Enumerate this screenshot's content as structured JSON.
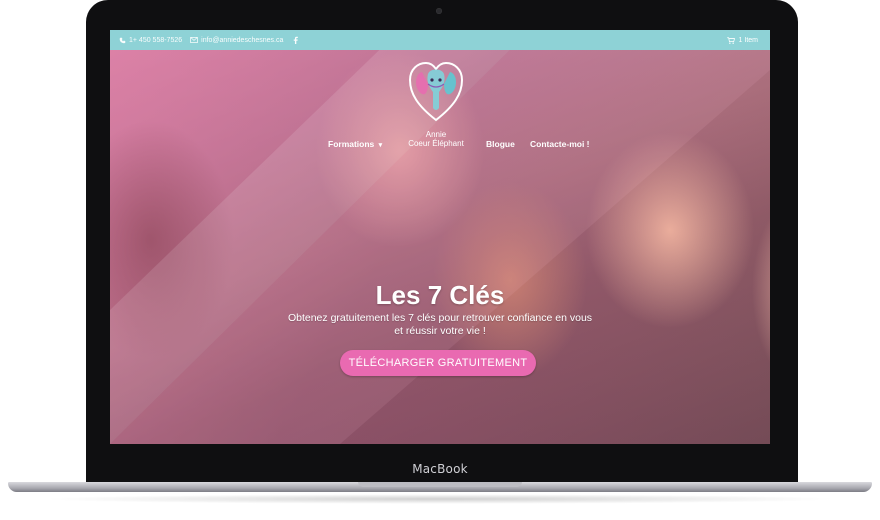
{
  "device": {
    "brand": "MacBook"
  },
  "topbar": {
    "phone": "1+ 450 558-7526",
    "email": "info@anniedeschesnes.ca",
    "cart": "1 Item",
    "phone_icon": "phone-icon",
    "email_icon": "envelope-icon",
    "facebook_icon": "facebook-icon",
    "cart_icon": "cart-icon"
  },
  "logo": {
    "line1": "Annie",
    "line2": "Coeur Éléphant",
    "icon": "elephant-heart-logo"
  },
  "nav": {
    "formations": "Formations",
    "blogue": "Blogue",
    "contact": "Contacte-moi !"
  },
  "hero": {
    "title": "Les 7 Clés",
    "subtitle_line1": "Obtenez gratuitement les 7 clés pour retrouver confiance en vous",
    "subtitle_line2": "et réussir votre vie !",
    "cta": "TÉLÉCHARGER GRATUITEMENT"
  },
  "colors": {
    "topbar": "#8ed2d6",
    "cta": "#e96ab1",
    "overlay": "#e878aa"
  }
}
